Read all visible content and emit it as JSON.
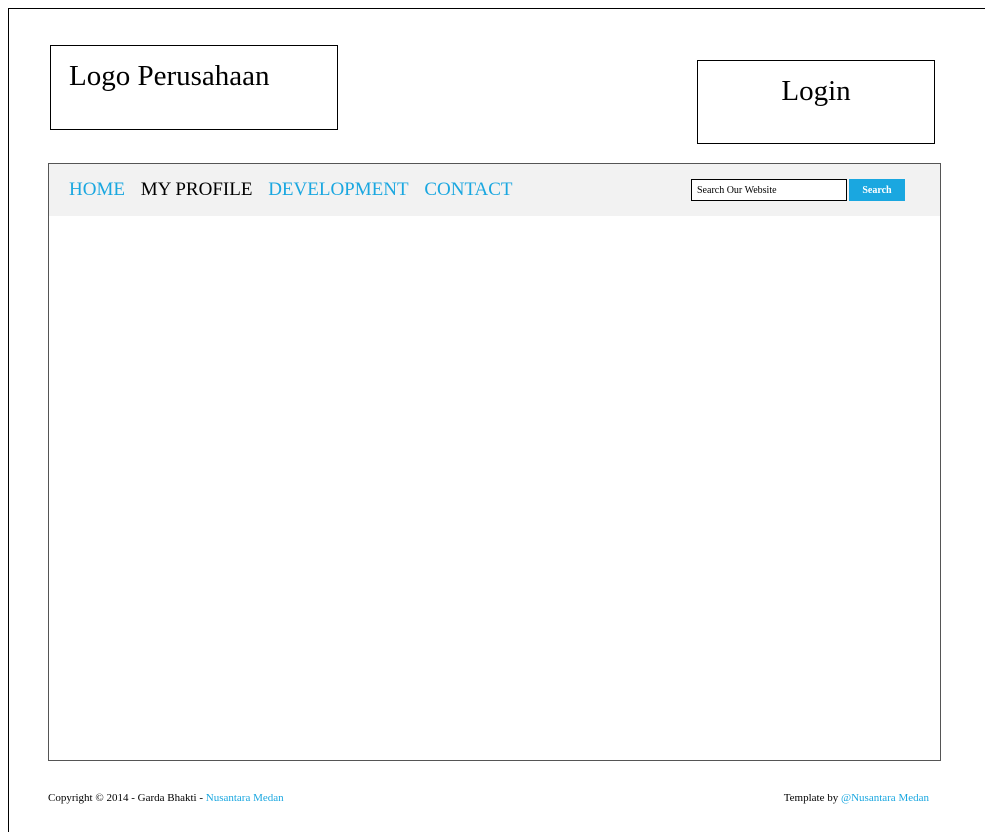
{
  "header": {
    "logo_text": "Logo Perusahaan",
    "login_text": "Login"
  },
  "nav": {
    "items": [
      {
        "label": "HOME",
        "active": false
      },
      {
        "label": "MY PROFILE",
        "active": true
      },
      {
        "label": "DEVELOPMENT",
        "active": false
      },
      {
        "label": "CONTACT",
        "active": false
      }
    ]
  },
  "search": {
    "placeholder": "Search Our Website",
    "button_label": "Search"
  },
  "footer": {
    "left_prefix": "Copyright © 2014 - Garda Bhakti - ",
    "left_link": "Nusantara Medan",
    "right_prefix": "Template by ",
    "right_link": "@Nusantara Medan"
  },
  "colors": {
    "accent": "#1aa7e0",
    "navbar_bg": "#f2f2f2"
  }
}
